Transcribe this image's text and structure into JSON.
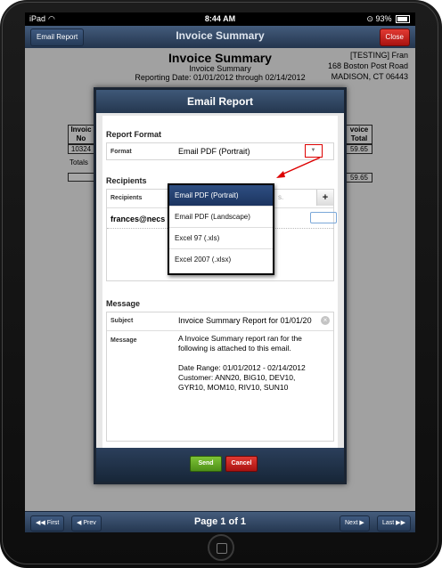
{
  "statusbar": {
    "device": "iPad",
    "time": "8:44 AM",
    "battery": "93%"
  },
  "navbar": {
    "left_button": "Email Report",
    "title": "Invoice Summary",
    "right_button": "Close"
  },
  "report": {
    "title": "Invoice Summary",
    "subtitle": "Invoice Summary",
    "dates": "Reporting Date: 01/01/2012 through 02/14/2012",
    "address": [
      "[TESTING] Fran",
      "168 Boston Post Road",
      "MADISON, CT 06443"
    ],
    "col_left_header": "Invoic\nNo",
    "col_left_value": "10324",
    "totals_label": "Totals",
    "col_right_header": "voice\nTotal",
    "col_right_value": "59.65",
    "total_value": "59.65"
  },
  "modal": {
    "title": "Email Report",
    "report_format_title": "Report Format",
    "format_label": "Format",
    "format_value": "Email PDF (Portrait)",
    "recipients_title": "Recipients",
    "recipients_label": "Recipients",
    "recipients_placeholder": "s.",
    "add_button": "+",
    "recipient_email": "frances@necs",
    "message_title": "Message",
    "subject_label": "Subject",
    "subject_value": "Invoice Summary Report for 01/01/20",
    "message_label": "Message",
    "message_lines": [
      "A Invoice Summary report ran for the",
      "following is attached to this email.",
      "",
      "Date Range: 01/01/2012 - 02/14/2012",
      "Customer: ANN20, BIG10, DEV10,",
      "GYR10, MOM10, RIV10, SUN10"
    ],
    "send_button": "Send",
    "cancel_button": "Cancel"
  },
  "dropdown": {
    "options": [
      "Email PDF (Portrait)",
      "Email PDF (Landscape)",
      "Excel 97 (.xls)",
      "Excel 2007 (.xlsx)"
    ],
    "selected_index": 0
  },
  "pager": {
    "first": "First",
    "prev": "Prev",
    "label": "Page 1 of 1",
    "next": "Next",
    "last": "Last"
  },
  "colors": {
    "nav_blue": "#2d4463",
    "close_red": "#c41a16",
    "send_green": "#5fa323",
    "annotation_red": "#dd0000"
  }
}
